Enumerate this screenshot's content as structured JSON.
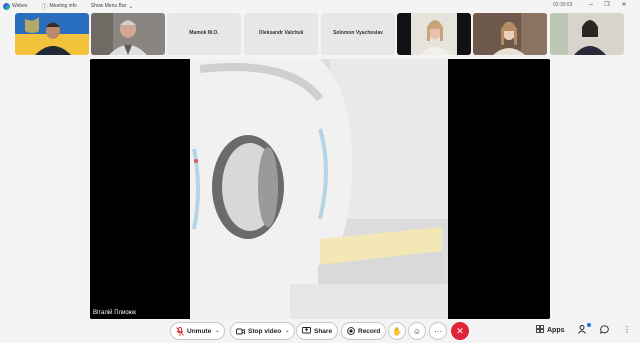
{
  "titlebar": {
    "app_name": "Webex",
    "meeting_info": "Meeting info",
    "show_menu_bar": "Show Menu Bar",
    "clock": "02:39:53",
    "minimize": "–",
    "restore": "❐",
    "close": "✕"
  },
  "participants": [
    {
      "name": "",
      "has_video": true
    },
    {
      "name": "",
      "has_video": true
    },
    {
      "name": "Mamok M.O.",
      "has_video": false
    },
    {
      "name": "Oleksandr Valchuk",
      "has_video": false
    },
    {
      "name": "Solomon Vyacheslav",
      "has_video": false
    },
    {
      "name": "",
      "has_video": true
    },
    {
      "name": "",
      "has_video": true
    },
    {
      "name": "",
      "has_video": true
    }
  ],
  "stage": {
    "speaker_name": "Віталій Плиоюк"
  },
  "controls": {
    "unmute": "Unmute",
    "stop_video": "Stop video",
    "share": "Share",
    "record": "Record",
    "more": "···",
    "apps": "Apps"
  },
  "colors": {
    "leave": "#e0243a",
    "mute": "#d0302f",
    "accent": "#1677d9"
  }
}
